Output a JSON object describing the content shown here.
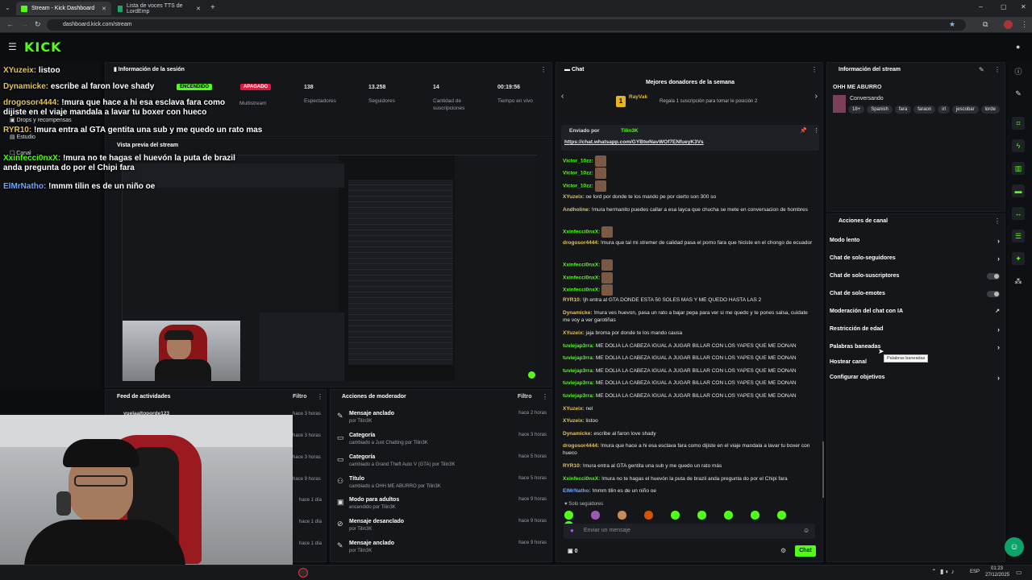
{
  "browser": {
    "tabs": [
      {
        "label": "Stream - Kick Dashboard",
        "active": true
      },
      {
        "label": "Lista de voces TTS de LordEmp",
        "active": false
      }
    ],
    "url": "dashboard.kick.com/stream"
  },
  "kick": {
    "logo": "KICK"
  },
  "overlay_chat": [
    {
      "user": "XYuzeix:",
      "text": "listoo"
    },
    {
      "user": "Dynamicke:",
      "text": "escribe al faron love shady"
    },
    {
      "user": "drogosor4444:",
      "text": "!mura que hace a hi esa esclava fara como dijiste en el viaje mandala a lavar tu boxer con hueco"
    },
    {
      "user": "RYR10:",
      "text": "!mura entra al GTA gentita una sub y me quedo un rato mas"
    },
    {
      "user": "Xxinfecci0nxX:",
      "text": "!mura no te hagas el huevón la puta de brazil anda pregunta do por el Chipi fara"
    },
    {
      "user": "ElMrNatho:",
      "text": "!mmm tilin es de un niño oe"
    }
  ],
  "session": {
    "title": "Información de la sesión",
    "on_badge": "ENCENDIDO",
    "off_badge": "APAGADO",
    "multistream": "Multistream",
    "stats": [
      {
        "value": "138",
        "label": "Espectadores"
      },
      {
        "value": "13.258",
        "label": "Seguidores"
      },
      {
        "value": "14",
        "label": "Cantidad de suscripciones"
      },
      {
        "value": "00:19:56",
        "label": "Tiempo en vivo"
      }
    ]
  },
  "left_menu": {
    "items": [
      "Drops y recompensas",
      "Estudio",
      "Canal"
    ]
  },
  "preview": {
    "title": "Vista previa del stream"
  },
  "activity_feed": {
    "title": "Feed de actividades",
    "filter": "Filtro",
    "first_user": "yuelaaltoporde123",
    "times": [
      "hace 3 horas",
      "hace 3 horas",
      "hace 3 horas",
      "hace 9 horas",
      "hace 1 día",
      "hace 1 día",
      "hace 1 día"
    ]
  },
  "mod_actions": {
    "title": "Acciones de moderador",
    "filter": "Filtro",
    "rows": [
      {
        "icon": "pin-icon",
        "title": "Mensaje anclado",
        "sub": "por Tilin3K",
        "time": "hace 2 horas"
      },
      {
        "icon": "category-icon",
        "title": "Categoría",
        "sub": "cambiado a Just Chatting por Tilin3K",
        "time": "hace 3 horas"
      },
      {
        "icon": "category-icon",
        "title": "Categoría",
        "sub": "cambiado a Grand Theft Auto V (GTA) por Tilin3K",
        "time": "hace 5 horas"
      },
      {
        "icon": "title-icon",
        "title": "Título",
        "sub": "cambiado a OHH ME ABURRO por Tilin3K",
        "time": "hace 5 horas"
      },
      {
        "icon": "adult-icon",
        "title": "Modo para adultos",
        "sub": "encendido por Tilin3K",
        "time": "hace 9 horas"
      },
      {
        "icon": "unpin-icon",
        "title": "Mensaje desanclado",
        "sub": "por Tilin3K",
        "time": "hace 9 horas"
      },
      {
        "icon": "pin-icon",
        "title": "Mensaje anclado",
        "sub": "por Tilin3K",
        "time": "hace 9 horas"
      }
    ]
  },
  "chat": {
    "title": "Chat",
    "top_donors_title": "Mejores donadores de la semana",
    "donor_rank": "1",
    "donor_name": "RayVak",
    "donor_hint": "Regala 1 suscripción para tomar le posición 2",
    "pinned_by_label": "Enviado por",
    "pinned_by_user": "Tilin3K",
    "pinned_link": "https://chat.whatsapp.com/GYBtwNavWOf7ENfueyK3Vs",
    "messages": [
      {
        "user": "Victor_10zz:",
        "text": "",
        "color": "#53fc18",
        "emote": true
      },
      {
        "user": "Victor_10zz:",
        "text": "",
        "color": "#53fc18",
        "emote": true
      },
      {
        "user": "Victor_10zz:",
        "text": "",
        "color": "#53fc18",
        "emote": true
      },
      {
        "user": "XYuzeix:",
        "text": "oe lord por donde te los mando pe por cierto son 300 so",
        "color": "#e7c347"
      },
      {
        "user": "Andholine:",
        "text": "!mura hermanito puedes callar a esa layca que chucha se mete en conversacion de hombres",
        "color": "#e7c347"
      },
      {
        "user": "Xxinfecci0nxX:",
        "text": "",
        "color": "#53fc18",
        "emote": true
      },
      {
        "user": "drogosor4444:",
        "text": "!mura que tal mi stremer de calidad pasa el porno fara que hiciste en el chongo de ecuador",
        "color": "#e7c347"
      },
      {
        "user": "Xxinfecci0nxX:",
        "text": "",
        "color": "#53fc18",
        "emote": true
      },
      {
        "user": "Xxinfecci0nxX:",
        "text": "",
        "color": "#53fc18",
        "emote": true
      },
      {
        "user": "Xxinfecci0nxX:",
        "text": "",
        "color": "#53fc18",
        "emote": true
      },
      {
        "user": "RYR10:",
        "text": "!jh entra al GTA DONDE ESTA 50 SOLES MAS Y ME QUEDO HASTA LAS 2",
        "color": "#e7c347"
      },
      {
        "user": "Dynamicke:",
        "text": "!mura ves huevon, pasa un rato a bajar pepa para ver si me quedo y te pones salsa, cuidate me voy a ver garotiñas",
        "color": "#e7c347"
      },
      {
        "user": "XYuzeix:",
        "text": "jaja broma por donde te los mando causa",
        "color": "#e7c347"
      },
      {
        "user": "tuviejap3rra:",
        "text": "ME DOLIA LA CABEZA IGUAL A JUGAR BILLAR CON LOS YAPES QUE ME DONAN",
        "color": "#53fc18"
      },
      {
        "user": "tuviejap3rra:",
        "text": "ME DOLIA LA CABEZA IGUAL A JUGAR BILLAR CON LOS YAPES QUE ME DONAN",
        "color": "#53fc18"
      },
      {
        "user": "tuviejap3rra:",
        "text": "ME DOLIA LA CABEZA IGUAL A JUGAR BILLAR CON LOS YAPES QUE ME DONAN",
        "color": "#53fc18"
      },
      {
        "user": "tuviejap3rra:",
        "text": "ME DOLIA LA CABEZA IGUAL A JUGAR BILLAR CON LOS YAPES QUE ME DONAN",
        "color": "#53fc18"
      },
      {
        "user": "tuviejap3rra:",
        "text": "ME DOLIA LA CABEZA IGUAL A JUGAR BILLAR CON LOS YAPES QUE ME DONAN",
        "color": "#53fc18"
      },
      {
        "user": "XYuzeix:",
        "text": "nel",
        "color": "#e7c347"
      },
      {
        "user": "XYuzeix:",
        "text": "listoo",
        "color": "#e7c347"
      },
      {
        "user": "Dynamicke:",
        "text": "escribe al faron love shady",
        "color": "#e7c347"
      },
      {
        "user": "drogosor4444:",
        "text": "!mura que hace a hi esa esclava fara como dijiste en el viaje mandala a lavar tu boxer con hueco",
        "color": "#e7c347"
      },
      {
        "user": "RYR10:",
        "text": "!mura entra al GTA gentita una sub y me quedo un rato más",
        "color": "#e7c347"
      },
      {
        "user": "Xxinfecci0nxX:",
        "text": "!mura no te hagas el huevón la puta de brazil anda pregunta do por el Chipi fara",
        "color": "#53fc18"
      },
      {
        "user": "ElMrNatho:",
        "text": "!mmm tilin es de un niño oe",
        "color": "#6aa8ff"
      }
    ],
    "followers_only": "Solo seguidores",
    "input_placeholder": "Enviar un mensaje",
    "count": "0",
    "send_button": "Chat"
  },
  "stream_info": {
    "title": "Información del stream",
    "stream_title": "OHH ME ABURRO",
    "category": "Conversando",
    "tags": [
      "18+",
      "Spanish",
      "fara",
      "faraon",
      "irl",
      "jescobar",
      "lorde"
    ]
  },
  "channel_actions": {
    "title": "Acciones de canal",
    "items": [
      {
        "label": "Modo lento",
        "control": "chevron"
      },
      {
        "label": "Chat de solo-seguidores",
        "control": "chevron"
      },
      {
        "label": "Chat de solo-suscriptores",
        "control": "toggle"
      },
      {
        "label": "Chat de solo-emotes",
        "control": "toggle"
      },
      {
        "label": "Moderación del chat con IA",
        "control": "external"
      },
      {
        "label": "Restricción de edad",
        "control": "chevron"
      },
      {
        "label": "Palabras baneadas",
        "control": "chevron"
      },
      {
        "label": "Hostear canal",
        "control": "none"
      },
      {
        "label": "Configurar objetivos",
        "control": "chevron"
      }
    ],
    "tooltip": "Palabras baneadas"
  },
  "taskbar": {
    "lang": "ESP",
    "time": "01:23",
    "date": "27/12/2025"
  },
  "colors": {
    "brand": "#53fc18",
    "on": "#53fc18",
    "off": "#e5173f"
  }
}
